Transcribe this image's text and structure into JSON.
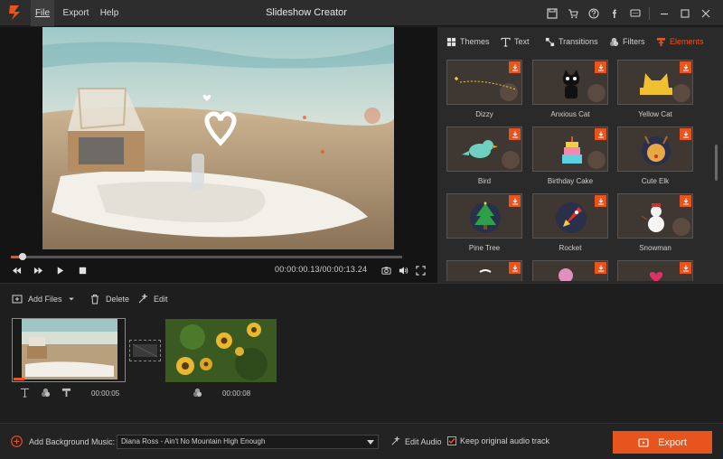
{
  "app": {
    "title": "Slideshow Creator"
  },
  "menu": {
    "file": "File",
    "export": "Export",
    "help": "Help"
  },
  "player": {
    "timecode": "00:00:00.13/00:00:13.24",
    "progress": 0.03
  },
  "panel_tabs": [
    {
      "label": "Themes"
    },
    {
      "label": "Text"
    },
    {
      "label": "Transitions"
    },
    {
      "label": "Filters"
    },
    {
      "label": "Elements"
    }
  ],
  "elements": [
    {
      "label": "Dizzy"
    },
    {
      "label": "Anxious Cat"
    },
    {
      "label": "Yellow Cat"
    },
    {
      "label": "Bird"
    },
    {
      "label": "Birthday Cake"
    },
    {
      "label": "Cute Elk"
    },
    {
      "label": "Pine Tree"
    },
    {
      "label": "Rocket"
    },
    {
      "label": "Snowman"
    }
  ],
  "toolbar": {
    "add_files": "Add Files",
    "delete": "Delete",
    "edit": "Edit"
  },
  "clips": [
    {
      "duration": "00:00:05"
    },
    {
      "duration": "00:00:08"
    }
  ],
  "bottom": {
    "bgm_label": "Add Background Music:",
    "bgm_track": "Diana Ross - Ain't No Mountain High Enough",
    "edit_audio": "Edit Audio",
    "keep_audio": "Keep original audio track",
    "export": "Export"
  },
  "colors": {
    "accent": "#e8541e",
    "background": "#1e1e1e",
    "panel": "#2a2a2a"
  }
}
